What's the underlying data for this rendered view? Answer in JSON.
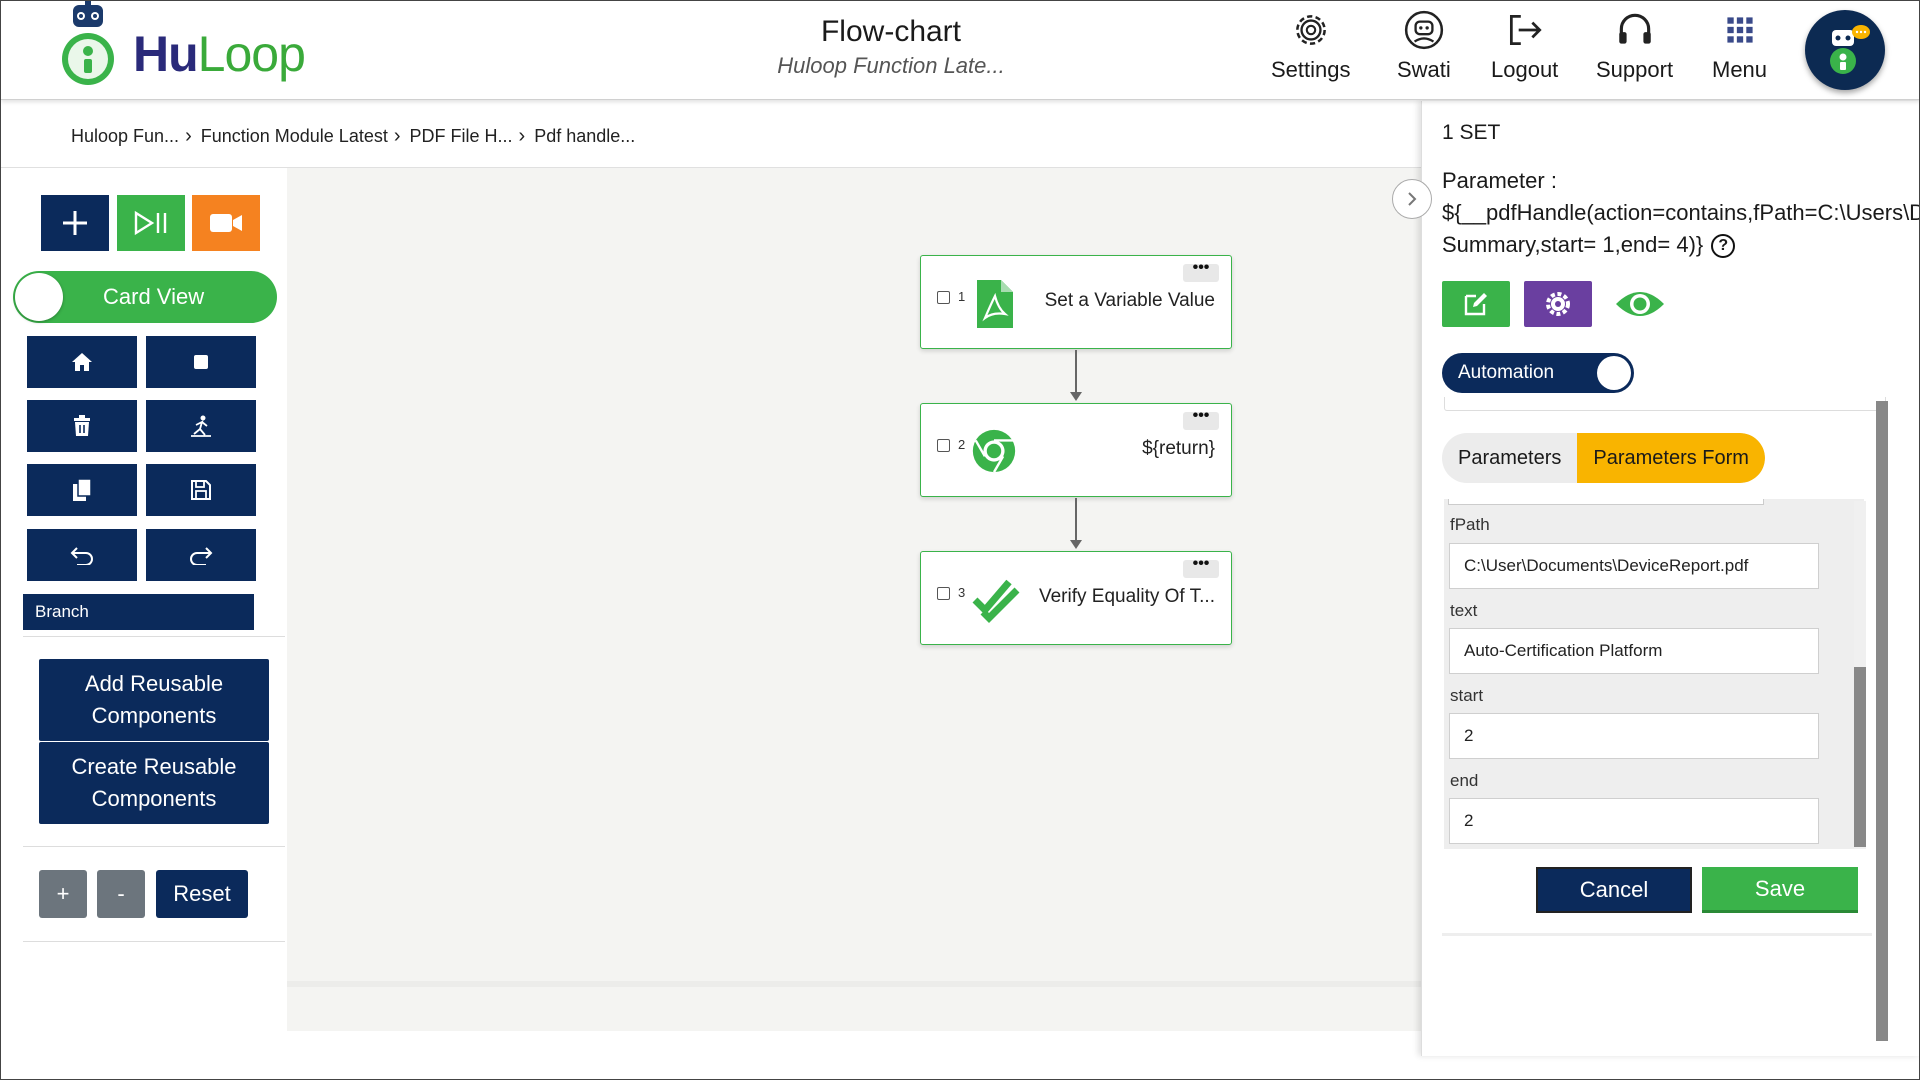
{
  "app": {
    "logo_hu": "Hu",
    "logo_loop": "Loop"
  },
  "header": {
    "title": "Flow-chart",
    "subtitle": "Huloop Function Late...",
    "nav": [
      {
        "label": "Settings",
        "icon": "gear-icon"
      },
      {
        "label": "Swati",
        "icon": "user-icon"
      },
      {
        "label": "Logout",
        "icon": "logout-icon"
      },
      {
        "label": "Support",
        "icon": "headset-icon"
      },
      {
        "label": "Menu",
        "icon": "grid-icon"
      }
    ]
  },
  "breadcrumb": [
    "Huloop Fun...",
    "Function Module Latest",
    "PDF File H...",
    "Pdf handle..."
  ],
  "toolbar": {
    "add_icon": "plus-icon",
    "play_icon": "play-pause-icon",
    "record_icon": "video-icon",
    "view_toggle_label": "Card View",
    "grid_icons": [
      "home-icon",
      "stop-icon",
      "trash-icon",
      "run-icon",
      "copy-icon",
      "save-icon",
      "undo-icon",
      "redo-icon"
    ],
    "branch_label": "Branch",
    "add_reusable": "Add Reusable Components",
    "create_reusable": "Create Reusable Components",
    "zoom_in": "+",
    "zoom_out": "-",
    "reset": "Reset"
  },
  "flow": {
    "nodes": [
      {
        "num": "1",
        "label": "Set a Variable Value",
        "icon": "pdf-icon"
      },
      {
        "num": "2",
        "label": "${return}",
        "icon": "chrome-icon"
      },
      {
        "num": "3",
        "label": "Verify Equality Of T...",
        "icon": "double-check-icon"
      }
    ],
    "more": "•••"
  },
  "panel": {
    "set_label": "1 SET",
    "parameter_label": "Parameter :",
    "parameter_line1": "${__pdfHandle(action=contains,fPath=C:\\Users\\Documents\\DeviceReport.pdf,text=Executive",
    "parameter_line2": "Summary,start= 1,end= 4)}",
    "help": "?",
    "automation_label": "Automation",
    "tabs": [
      "Parameters",
      "Parameters Form"
    ],
    "fields": [
      {
        "label": "fPath",
        "value": "C:\\User\\Documents\\DeviceReport.pdf"
      },
      {
        "label": "text",
        "value": "Auto-Certification Platform"
      },
      {
        "label": "start",
        "value": "2"
      },
      {
        "label": "end",
        "value": "2"
      }
    ],
    "cancel": "Cancel",
    "save": "Save"
  },
  "colors": {
    "navy": "#0b2a5b",
    "green": "#3ab34a",
    "orange": "#f58220",
    "purple": "#6a3fa0",
    "amber": "#f9b400"
  }
}
